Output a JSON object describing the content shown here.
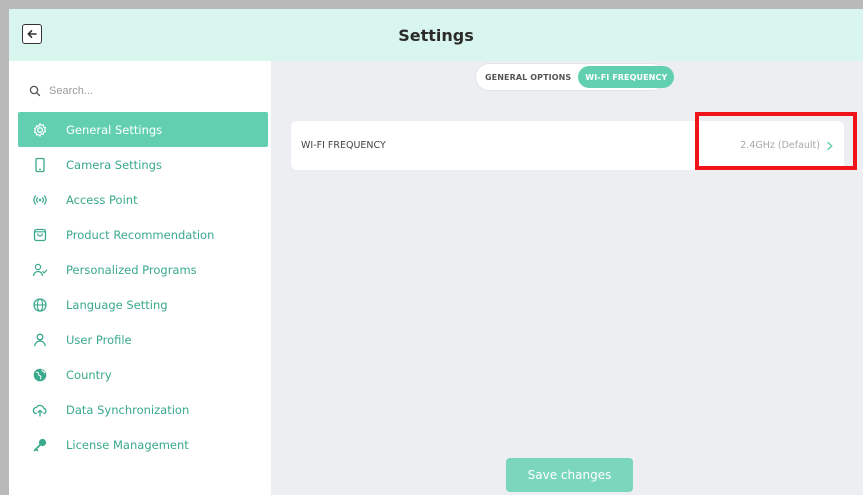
{
  "header": {
    "title": "Settings",
    "back_icon": "arrow-left-icon"
  },
  "search": {
    "placeholder": "Search..."
  },
  "sidebar": {
    "items": [
      {
        "label": "General Settings",
        "icon": "gear-icon",
        "active": true
      },
      {
        "label": "Camera Settings",
        "icon": "tablet-icon",
        "active": false
      },
      {
        "label": "Access Point",
        "icon": "wireless-icon",
        "active": false
      },
      {
        "label": "Product Recommendation",
        "icon": "bag-icon",
        "active": false
      },
      {
        "label": "Personalized Programs",
        "icon": "user-check-icon",
        "active": false
      },
      {
        "label": "Language Setting",
        "icon": "globe-icon",
        "active": false
      },
      {
        "label": "User Profile",
        "icon": "user-icon",
        "active": false
      },
      {
        "label": "Country",
        "icon": "earth-icon",
        "active": false
      },
      {
        "label": "Data Synchronization",
        "icon": "cloud-upload-icon",
        "active": false
      },
      {
        "label": "License Management",
        "icon": "key-icon",
        "active": false
      }
    ]
  },
  "tabs": [
    {
      "label": "GENERAL OPTIONS",
      "active": false
    },
    {
      "label": "WI-FI FREQUENCY",
      "active": true
    }
  ],
  "wifi_row": {
    "label": "WI-FI FREQUENCY",
    "value": "2.4GHz (Default)"
  },
  "save_label": "Save changes",
  "colors": {
    "accent": "#62d0b0",
    "header_bg": "#d9f6ee",
    "content_bg": "#eceef1",
    "menu_text": "#3aa98c",
    "highlight": "#f0141a"
  }
}
